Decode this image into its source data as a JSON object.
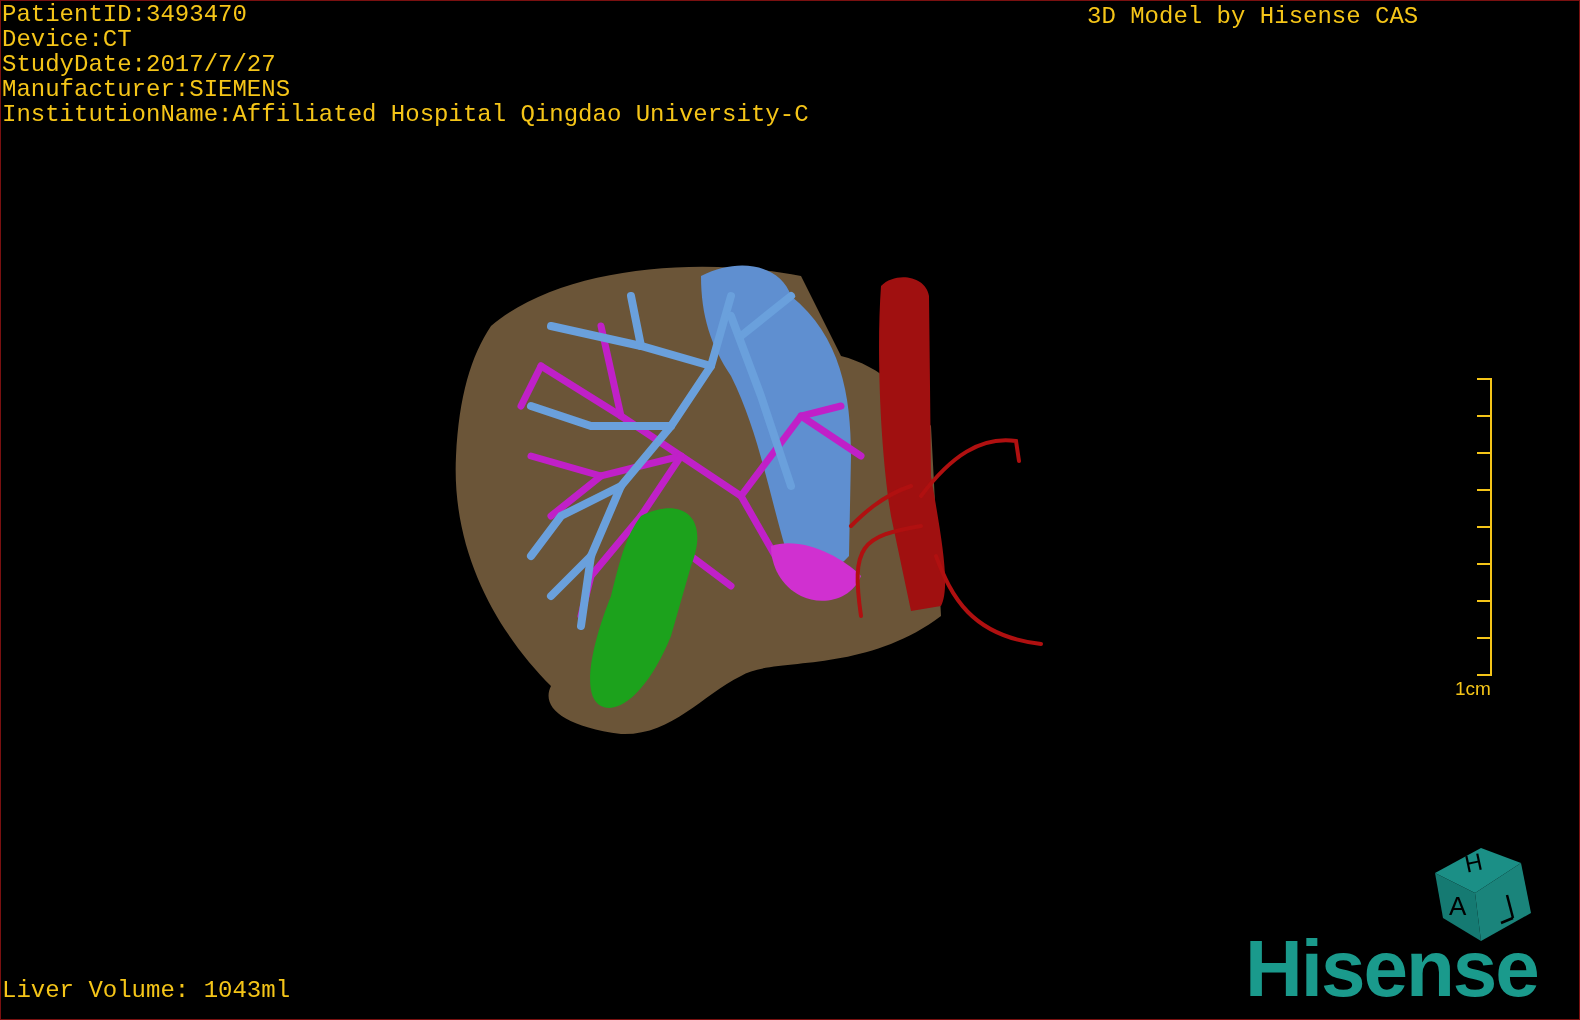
{
  "study_info": [
    "PatientID:3493470",
    "Device:CT",
    "StudyDate:2017/7/27",
    "Manufacturer:SIEMENS",
    "InstitutionName:Affiliated Hospital Qingdao University-C"
  ],
  "model_caption": "3D Model by Hisense CAS",
  "scale_bar": {
    "label": "1cm"
  },
  "orientation_cube": {
    "top_label": "H",
    "front_label": "A"
  },
  "liver_volume": "Liver Volume: 1043ml",
  "logo": "Hisense"
}
